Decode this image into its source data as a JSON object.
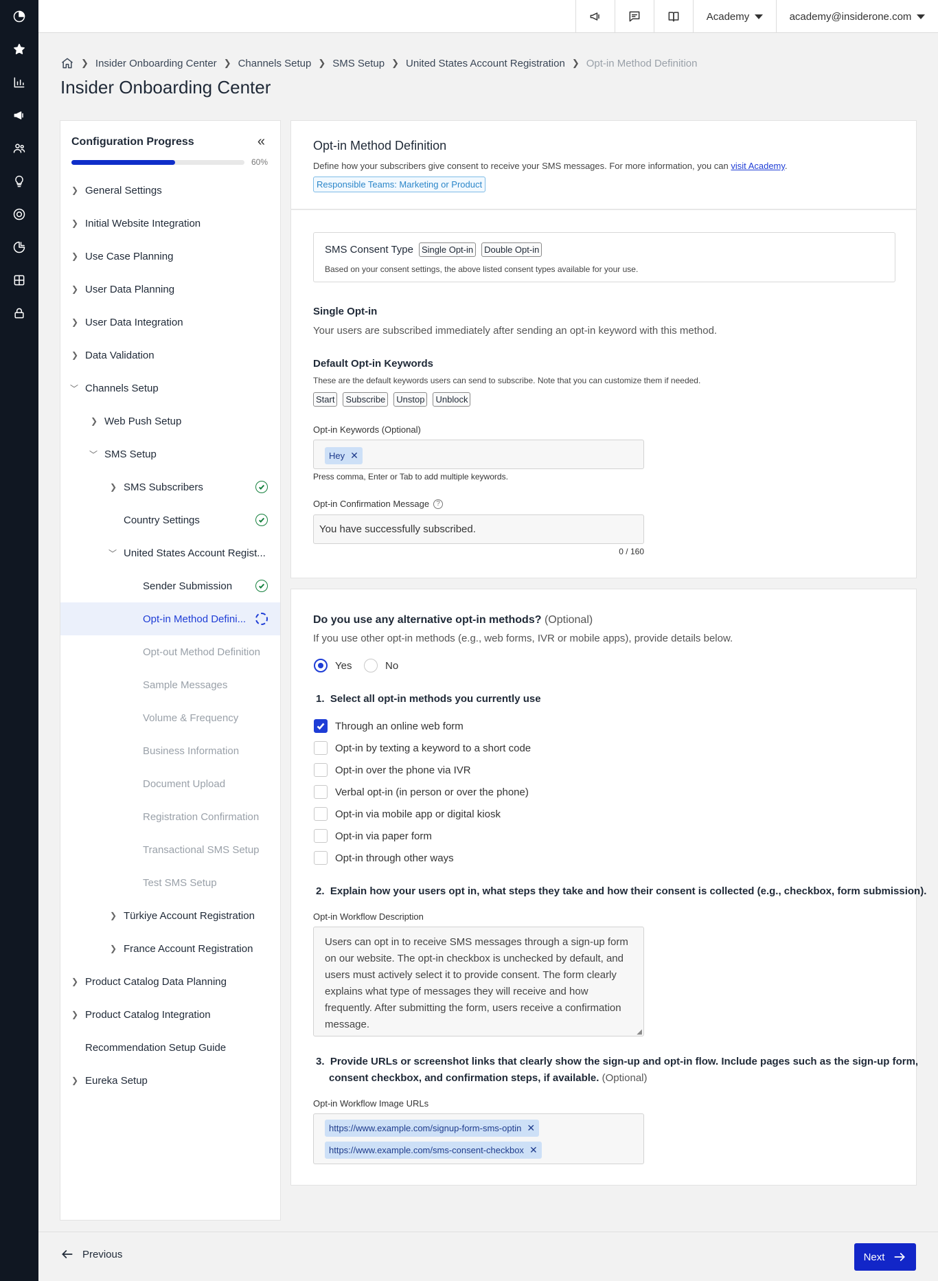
{
  "topbar": {
    "academy_label": "Academy",
    "account_label": "academy@insiderone.com"
  },
  "breadcrumb": {
    "items": [
      "Insider Onboarding Center",
      "Channels Setup",
      "SMS Setup",
      "United States Account Registration"
    ],
    "current": "Opt-in Method Definition"
  },
  "page_title": "Insider Onboarding Center",
  "sidebar": {
    "title": "Configuration Progress",
    "progress_percent": 60,
    "progress_label": "60%",
    "items": [
      {
        "label": "General Settings"
      },
      {
        "label": "Initial Website Integration"
      },
      {
        "label": "Use Case Planning"
      },
      {
        "label": "User Data Planning"
      },
      {
        "label": "User Data Integration"
      },
      {
        "label": "Data Validation"
      },
      {
        "label": "Channels Setup"
      },
      {
        "label": "Web Push Setup"
      },
      {
        "label": "SMS Setup"
      },
      {
        "label": "SMS Subscribers"
      },
      {
        "label": "Country Settings"
      },
      {
        "label": "United States Account Regist..."
      },
      {
        "label": "Sender Submission"
      },
      {
        "label": "Opt-in Method Defini..."
      },
      {
        "label": "Opt-out Method Definition"
      },
      {
        "label": "Sample Messages"
      },
      {
        "label": "Volume & Frequency"
      },
      {
        "label": "Business Information"
      },
      {
        "label": "Document Upload"
      },
      {
        "label": "Registration Confirmation"
      },
      {
        "label": "Transactional SMS Setup"
      },
      {
        "label": "Test SMS Setup"
      },
      {
        "label": "Türkiye Account Registration"
      },
      {
        "label": "France Account Registration"
      },
      {
        "label": "Product Catalog Data Planning"
      },
      {
        "label": "Product Catalog Integration"
      },
      {
        "label": "Recommendation Setup Guide"
      },
      {
        "label": "Eureka Setup"
      }
    ]
  },
  "header_card": {
    "title": "Opt-in Method Definition",
    "description": "Define how your subscribers give consent to receive your SMS messages. For more information, you can",
    "link_text": "visit Academy",
    "link_suffix": ".",
    "teams_badge": "Responsible Teams: Marketing or Product"
  },
  "consent": {
    "label": "SMS Consent Type",
    "types": [
      "Single Opt-in",
      "Double Opt-in"
    ],
    "note": "Based on your consent settings, the above listed consent types available for your use."
  },
  "single_optin": {
    "title": "Single Opt-in",
    "description": "Your users are subscribed immediately after sending an opt-in keyword with this method."
  },
  "default_keywords": {
    "title": "Default Opt-in Keywords",
    "description": "These are the default keywords users can send to subscribe. Note that you can customize them if needed.",
    "keywords": [
      "Start",
      "Subscribe",
      "Unstop",
      "Unblock"
    ]
  },
  "optin_keywords": {
    "label": "Opt-in Keywords (Optional)",
    "chips": [
      "Hey"
    ],
    "hint": "Press comma, Enter or Tab to add multiple keywords."
  },
  "confirmation": {
    "label": "Opt-in Confirmation Message",
    "value": "You have successfully subscribed.",
    "counter": "0 / 160"
  },
  "alternative": {
    "question": "Do you use any alternative opt-in methods?",
    "optional": "(Optional)",
    "description": "If you use other opt-in methods (e.g., web forms, IVR or mobile apps), provide details below.",
    "yes_label": "Yes",
    "no_label": "No",
    "selected": "Yes",
    "step1": "1.  Select all opt-in methods you currently use",
    "methods": [
      {
        "label": "Through an online web form",
        "checked": true
      },
      {
        "label": "Opt-in by texting a keyword to a short code",
        "checked": false
      },
      {
        "label": "Opt-in over the phone via IVR",
        "checked": false
      },
      {
        "label": "Verbal opt-in (in person or over the phone)",
        "checked": false
      },
      {
        "label": "Opt-in via mobile app or digital kiosk",
        "checked": false
      },
      {
        "label": "Opt-in via paper form",
        "checked": false
      },
      {
        "label": "Opt-in through other ways",
        "checked": false
      }
    ],
    "step2": "2.  Explain how your users opt in, what steps they take and how their consent is collected (e.g., checkbox, form submission).",
    "workflow_label": "Opt-in Workflow Description",
    "workflow_lines": [
      "Users can opt in to receive SMS messages through a sign-up form",
      "on our website. The opt-in checkbox is unchecked by default, and",
      "users must actively select it to provide consent. The form clearly",
      "explains what type of messages they will receive and how",
      "frequently. After submitting the form, users receive a confirmation",
      "message."
    ],
    "step3_line1": "3.  Provide URLs or screenshot links that clearly show the sign-up and opt-in flow. Include pages such as the sign-up form,",
    "step3_line2": "consent checkbox, and confirmation steps, if available.",
    "step3_optional": "(Optional)",
    "urls_label": "Opt-in Workflow Image URLs",
    "urls": [
      "https://www.example.com/signup-form-sms-optin",
      "https://www.example.com/sms-consent-checkbox"
    ]
  },
  "footer": {
    "previous_label": "Previous",
    "next_label": "Next"
  },
  "colors": {
    "accent": "#1226c8",
    "rail": "#101722",
    "success": "#15803d"
  }
}
